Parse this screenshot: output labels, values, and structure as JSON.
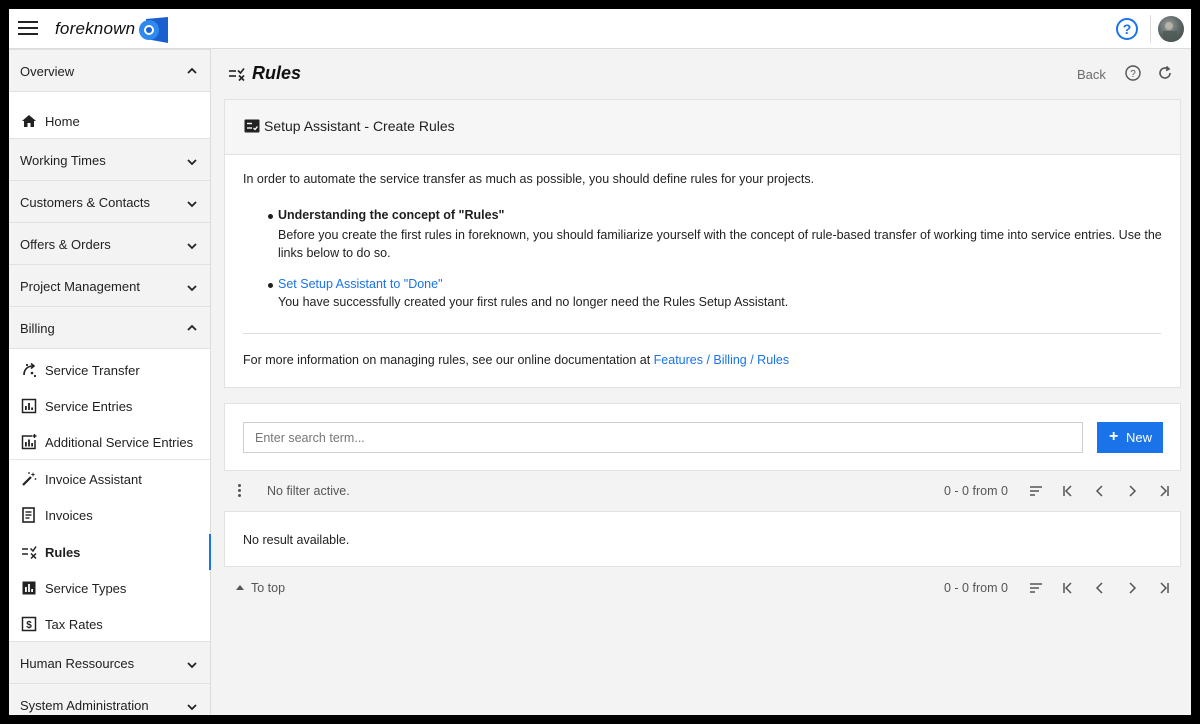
{
  "app": {
    "brand": "foreknown"
  },
  "sidebar": {
    "sections": [
      {
        "label": "Overview",
        "expanded": true
      },
      {
        "label": "Working Times",
        "expanded": false
      },
      {
        "label": "Customers & Contacts",
        "expanded": false
      },
      {
        "label": "Offers & Orders",
        "expanded": false
      },
      {
        "label": "Project Management",
        "expanded": false
      },
      {
        "label": "Billing",
        "expanded": true
      },
      {
        "label": "Human Ressources",
        "expanded": false
      },
      {
        "label": "System Administration",
        "expanded": false
      }
    ],
    "overview_items": [
      {
        "label": "Home",
        "icon": "home-icon"
      }
    ],
    "billing_items": [
      {
        "label": "Service Transfer",
        "icon": "transfer-icon"
      },
      {
        "label": "Service Entries",
        "icon": "chart-box-icon"
      },
      {
        "label": "Additional Service Entries",
        "icon": "chart-plus-icon"
      },
      {
        "label": "Invoice Assistant",
        "icon": "magic-wand-icon"
      },
      {
        "label": "Invoices",
        "icon": "invoice-icon"
      },
      {
        "label": "Rules",
        "icon": "rules-icon",
        "active": true
      },
      {
        "label": "Service Types",
        "icon": "bar-chart-icon"
      },
      {
        "label": "Tax Rates",
        "icon": "dollar-box-icon"
      }
    ]
  },
  "header": {
    "title": "Rules",
    "back_label": "Back"
  },
  "setup": {
    "title": "Setup Assistant - Create Rules",
    "intro": "In order to automate the service transfer as much as possible, you should define rules for your projects.",
    "bullet1_title": "Understanding the concept of \"Rules\"",
    "bullet1_text": "Before you create the first rules in foreknown, you should familiarize yourself with the concept of rule-based transfer of working time into service entries. Use the links below to do so.",
    "bullet2_link": "Set Setup Assistant to \"Done\"",
    "bullet2_text": "You have successfully created your first rules and no longer need the Rules Setup Assistant.",
    "more_text": "For more information on managing rules, see our online documentation at ",
    "more_link": "Features / Billing / Rules"
  },
  "search": {
    "placeholder": "Enter search term...",
    "value": "",
    "new_label": "New"
  },
  "filter": {
    "status": "No filter active."
  },
  "pager": {
    "count_text": "0 - 0 from 0"
  },
  "results": {
    "empty_text": "No result available."
  },
  "footer": {
    "to_top": "To top"
  },
  "colors": {
    "accent": "#1a73e8",
    "background": "#f3f3f4"
  }
}
